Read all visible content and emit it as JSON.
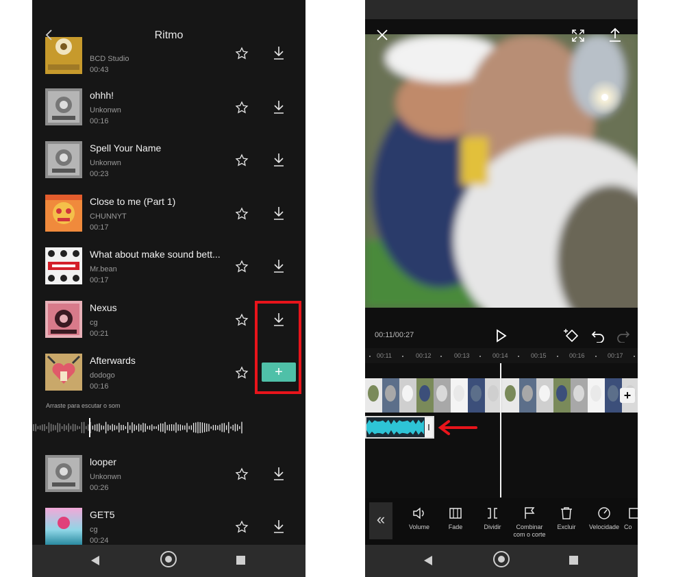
{
  "left": {
    "header": {
      "title": "Ritmo"
    },
    "tracks": [
      {
        "name": "",
        "artist": "BCD Studio",
        "duration": "00:43"
      },
      {
        "name": "ohhh!",
        "artist": "Unkonwn",
        "duration": "00:16"
      },
      {
        "name": "Spell Your Name",
        "artist": "Unkonwn",
        "duration": "00:23"
      },
      {
        "name": "Close to me (Part 1)",
        "artist": "CHUNNYT",
        "duration": "00:17"
      },
      {
        "name": "What about make sound bett...",
        "artist": "Mr.bean",
        "duration": "00:17"
      },
      {
        "name": "Nexus",
        "artist": "cg",
        "duration": "00:21"
      },
      {
        "name": "Afterwards",
        "artist": "dodogo",
        "duration": "00:16"
      },
      {
        "name": "looper",
        "artist": "Unkonwn",
        "duration": "00:26"
      },
      {
        "name": "GET5",
        "artist": "cg",
        "duration": "00:24"
      }
    ],
    "add_button": "+",
    "drag_hint": "Arraste para escutar o som"
  },
  "right": {
    "time": "00:11/00:27",
    "ruler": [
      "00:11",
      "00:12",
      "00:13",
      "00:14",
      "00:15",
      "00:16",
      "00:17"
    ],
    "add_clip": "+",
    "collapse": "«",
    "tools": [
      "Volume",
      "Fade",
      "Dividir",
      "Combinar com o corte",
      "Excluir",
      "Velocidade",
      "Co"
    ]
  },
  "colors": {
    "highlight": "#e8141b",
    "add_button": "#4fc0a8",
    "waveform": "#2ec4d6"
  }
}
